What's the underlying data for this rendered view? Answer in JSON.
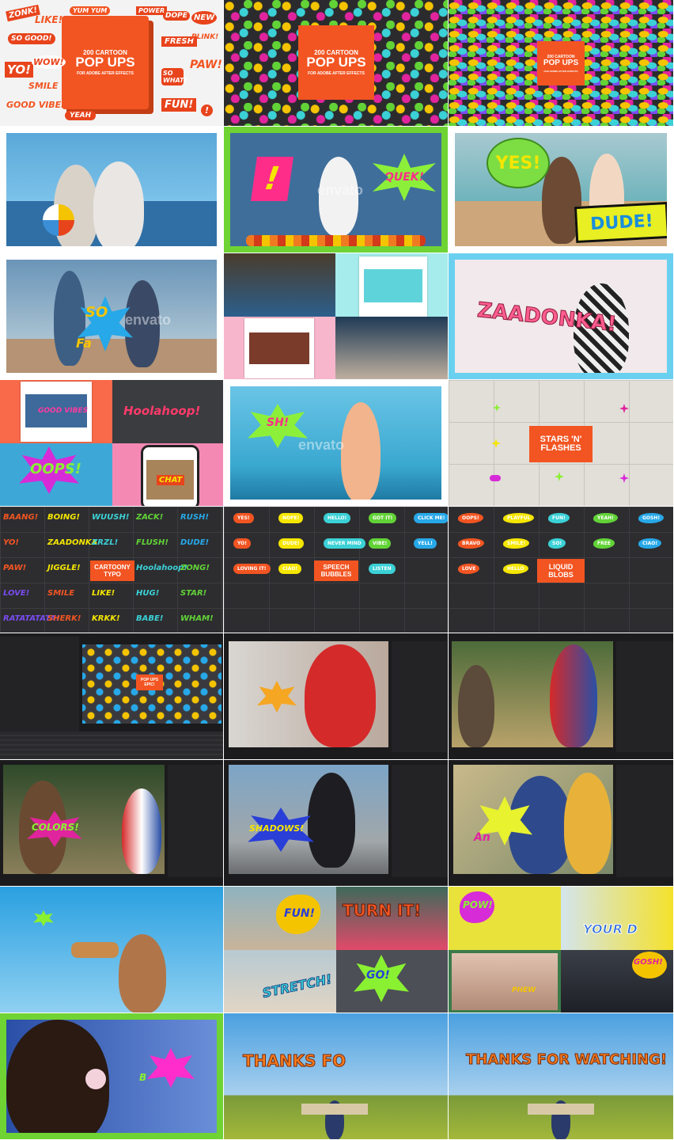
{
  "colors": {
    "accent": "#f25522",
    "green_frame": "#6fd334",
    "pink": "#f78fb3",
    "sky": "#56b4e6",
    "dark_grid": "#2a2a2d"
  },
  "tiles": {
    "t1": {
      "box_small": "200 CARTOON",
      "box_big": "POP UPS",
      "box_sub": "FOR ADOBE AFTER EFFECTS",
      "stickers": [
        "ZONK!",
        "LIKE!",
        "YUM YUM",
        "POWER",
        "DOPE",
        "NEW",
        "SO GOOD!",
        "FRESH",
        "PLINK!",
        "YO!",
        "WOW!",
        "PAW!",
        "SMILE",
        "SO WHAT?",
        "GOOD VIBES",
        "FUN!",
        "YEAH",
        "!"
      ]
    },
    "t2": {
      "box_small": "200 CARTOON",
      "box_big": "POP UPS",
      "box_sub": "FOR ADOBE AFTER EFFECTS"
    },
    "t3": {
      "box_small": "200 CARTOON",
      "box_big": "POP UPS",
      "box_sub": "FOR ADOBE AFTER EFFECTS"
    },
    "t5": {
      "bang": "!",
      "burst": "QUEK!",
      "watermark": "envato"
    },
    "t6": {
      "bubble": "YES!",
      "banner": "DUDE!"
    },
    "t7": {
      "burst": "SO",
      "burst2": "Fa",
      "watermark": "envato"
    },
    "t9": {
      "title": "ZAADONKA!"
    },
    "t10": {
      "a": "GOOD VIBES",
      "b": "Hoolahoop!",
      "c": "OOPS!",
      "d": "CHAT"
    },
    "t11": {
      "burst": "SH!",
      "watermark": "envato"
    },
    "t12": {
      "label_line1": "STARS 'N'",
      "label_line2": "FLASHES"
    },
    "t13": {
      "label_line1": "CARTOONY",
      "label_line2": "TYPO",
      "words": [
        "BAANG!",
        "BOING!",
        "WUUSH!",
        "ZACK!",
        "RUSH!",
        "YO!",
        "ZAADONKA",
        "ZRZL!",
        "FLUSH!",
        "DUDE!",
        "PAW!",
        "JIGGLE!",
        "Hoolahoop!",
        "ZONG!",
        "LOVE!",
        "SMILE",
        "LIKE!",
        "HUG!",
        "STAR!",
        "RATATATATA!",
        "SHERK!",
        "KRKK!",
        "BABE!",
        "WHAM!"
      ]
    },
    "t14": {
      "label_line1": "SPEECH",
      "label_line2": "BUBBLES",
      "bubbles": [
        "YES!",
        "NOPE!",
        "HELLO!",
        "GOT IT!",
        "CLICK ME!",
        "YO!",
        "DUDE!",
        "NEVER MIND",
        "VIBE!",
        "YELL!",
        "LOVING IT!",
        "CIAO!",
        "LISTEN"
      ]
    },
    "t15": {
      "label_line1": "LIQUID",
      "label_line2": "BLOBS",
      "blobs": [
        "OOPS!",
        "PLAYFUL",
        "FUN!",
        "YEAH!",
        "GOSH!",
        "BRAVO",
        "SMILE!",
        "SO!",
        "FREE",
        "CIAO!",
        "LOVE",
        "HELLO"
      ]
    },
    "t16": {
      "label_line1": "POP UPS",
      "label_line2": "EPIC!"
    },
    "t19": {
      "burst": "COLORS!"
    },
    "t20": {
      "burst": "SHADOWS!"
    },
    "t21": {
      "burst": "An"
    },
    "t23": {
      "a": "FUN!",
      "b": "TURN IT!",
      "c": "STRETCH!",
      "d": "GO!"
    },
    "t24": {
      "a": "POW!",
      "b": "YOUR D",
      "c": "PHEW",
      "d": "GOSH!"
    },
    "t25": {
      "burst": "B"
    },
    "t26": {
      "text": "THANKS FO"
    },
    "t27": {
      "text": "THANKS FOR WATCHING!"
    }
  }
}
